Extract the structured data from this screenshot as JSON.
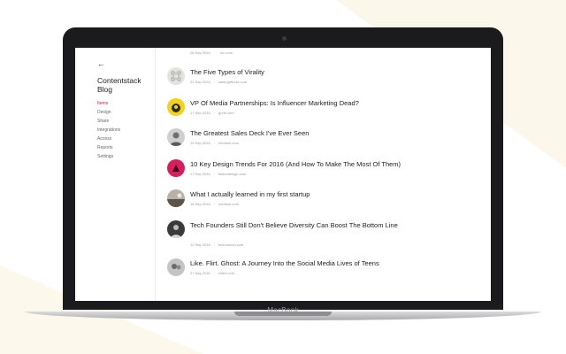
{
  "device": {
    "brand": "MacBook"
  },
  "sidebar": {
    "back_icon": "arrow-left-icon",
    "title": "Contentstack Blog",
    "nav": [
      {
        "label": "Items",
        "active": true
      },
      {
        "label": "Design",
        "active": false
      },
      {
        "label": "Share",
        "active": false
      },
      {
        "label": "Integrations",
        "active": false
      },
      {
        "label": "Access",
        "active": false
      },
      {
        "label": "Reports",
        "active": false
      },
      {
        "label": "Settings",
        "active": false
      }
    ]
  },
  "feed": {
    "top_meta": {
      "date": "26 Sep 2016",
      "source": "inc.com"
    },
    "items": [
      {
        "title": "The Five Types of Virality",
        "date": "22 Sep 2016",
        "source": "www.getlouis.com",
        "thumb_color": "#d9d9d4"
      },
      {
        "title": "VP Of Media Partnerships: Is Influencer Marketing Dead?",
        "date": "17 Sep 2016",
        "source": "grvth.com",
        "thumb_color": "#f2d21b"
      },
      {
        "title": "The Greatest Sales Deck I've Ever Seen",
        "date": "19 Sep 2016",
        "source": "medium.com",
        "thumb_color": "#bdbdbd"
      },
      {
        "title": "10 Key Design Trends For 2016 (And How To Make The Most Of Them)",
        "date": "17 Sep 2016",
        "source": "fastcodesign.com",
        "thumb_color": "#d81f5e"
      },
      {
        "title": "What I actually learned in my first startup",
        "date": "16 Sep 2016",
        "source": "medium.com",
        "thumb_color": "#8a8580"
      },
      {
        "title": "Tech Founders Still Don't Believe Diversity Can Boost The Bottom Line",
        "date": "12 Sep 2016",
        "source": "techcrunch.com",
        "thumb_color": "#3a3a3a"
      },
      {
        "title": "Like. Flirt. Ghost: A Journey Into the Social Media Lives of Teens",
        "date": "27 Aug 2016",
        "source": "wired.com",
        "thumb_color": "#a9a9a9"
      }
    ]
  }
}
